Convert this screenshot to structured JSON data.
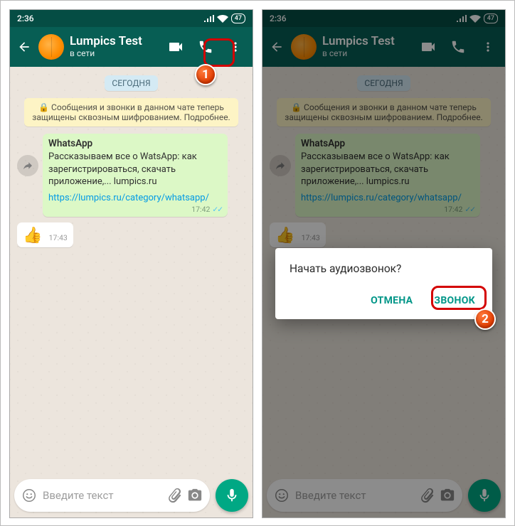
{
  "status": {
    "time": "2:36",
    "battery": "47"
  },
  "header": {
    "name": "Lumpics Test",
    "status": "в сети"
  },
  "chat": {
    "date_label": "СЕГОДНЯ",
    "encryption_notice": "🔒 Сообщения и звонки в данном чате теперь защищены сквозным шифрованием. Подробнее.",
    "msg1": {
      "title": "WhatsApp",
      "body": "Рассказываем все о WatsApp: как зарегистрироваться, скачать приложение,... lumpics.ru",
      "link": "https://lumpics.ru/category/whatsapp/",
      "time": "17:42"
    },
    "msg2": {
      "emoji": "👍",
      "time": "17:43"
    }
  },
  "input": {
    "placeholder": "Введите текст"
  },
  "dialog": {
    "title": "Начать аудиозвонок?",
    "cancel": "ОТМЕНА",
    "confirm": "ЗВОНОК"
  },
  "callouts": {
    "badge1": "1",
    "badge2": "2"
  },
  "icons": {
    "back": "arrow-back",
    "video": "video-camera",
    "call": "phone",
    "more": "more-vert",
    "emoji": "emoji",
    "attach": "paperclip",
    "camera": "camera",
    "mic": "microphone",
    "forward": "forward"
  }
}
